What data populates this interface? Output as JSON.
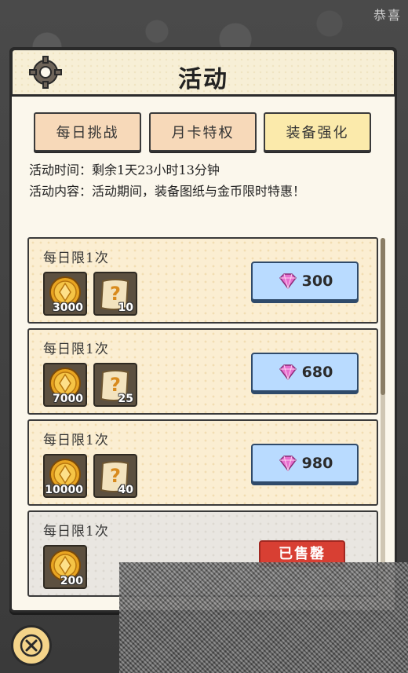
{
  "header": {
    "corner_text": "恭喜"
  },
  "panel": {
    "title": "活动"
  },
  "tabs": [
    {
      "label": "每日挑战",
      "active": false
    },
    {
      "label": "月卡特权",
      "active": false
    },
    {
      "label": "装备强化",
      "active": true
    }
  ],
  "info": {
    "time_line": "活动时间：剩余1天23小时13分钟",
    "content_line": "活动内容：活动期间，装备图纸与金币限时特惠！"
  },
  "offers": [
    {
      "limit": "每日限1次",
      "coins": "3000",
      "scrolls": "10",
      "price": "300",
      "sold": false
    },
    {
      "limit": "每日限1次",
      "coins": "7000",
      "scrolls": "25",
      "price": "680",
      "sold": false
    },
    {
      "limit": "每日限1次",
      "coins": "10000",
      "scrolls": "40",
      "price": "980",
      "sold": false
    },
    {
      "limit": "每日限1次",
      "coins": "200",
      "sold_label": "已售罄",
      "sold": true
    }
  ],
  "icons": {
    "panel": "gear-icon",
    "coin": "gold-coin-icon",
    "scroll": "mystery-scroll-icon",
    "gem": "pink-gem-icon",
    "close": "close-icon"
  },
  "colors": {
    "buy_button": "#b9dbff",
    "sold_stamp": "#d83f33",
    "active_tab": "#fbeaab",
    "tab": "#f7d9b9"
  }
}
